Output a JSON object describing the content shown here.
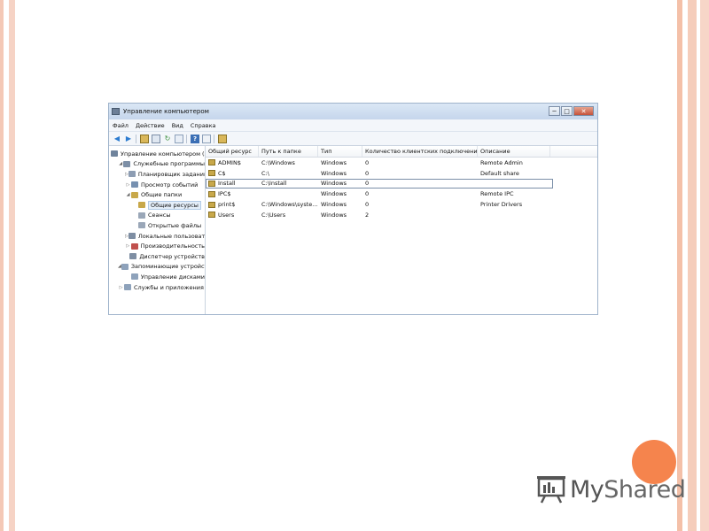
{
  "window": {
    "title": "Управление компьютером",
    "buttons": {
      "minimize": "─",
      "maximize": "□",
      "close": "✕"
    }
  },
  "menu": [
    "Файл",
    "Действие",
    "Вид",
    "Справка"
  ],
  "toolbar": [
    "back-icon",
    "forward-icon",
    "up-icon",
    "show-tree-icon",
    "refresh-icon",
    "export-icon",
    "help-icon",
    "properties-icon",
    "share-icon"
  ],
  "tree": [
    {
      "label": "Управление компьютером (л",
      "arrow": "",
      "indent": 0,
      "color": "#6f839c"
    },
    {
      "label": "Служебные программы",
      "arrow": "◢",
      "indent": 1,
      "color": "#7d8fa6"
    },
    {
      "label": "Планировщик заданий",
      "arrow": "▷",
      "indent": 2,
      "color": "#8d9db3"
    },
    {
      "label": "Просмотр событий",
      "arrow": "▷",
      "indent": 2,
      "color": "#7690b0"
    },
    {
      "label": "Общие папки",
      "arrow": "◢",
      "indent": 2,
      "color": "#c8a84a"
    },
    {
      "label": "Общие ресурсы",
      "arrow": "",
      "indent": 3,
      "color": "#c8a84a",
      "selected": true
    },
    {
      "label": "Сеансы",
      "arrow": "",
      "indent": 3,
      "color": "#9aa7b8"
    },
    {
      "label": "Открытые файлы",
      "arrow": "",
      "indent": 3,
      "color": "#9aa7b8"
    },
    {
      "label": "Локальные пользоват",
      "arrow": "▷",
      "indent": 2,
      "color": "#7e8ea3"
    },
    {
      "label": "Производительность",
      "arrow": "▷",
      "indent": 2,
      "color": "#c0504d"
    },
    {
      "label": "Диспетчер устройств",
      "arrow": "",
      "indent": 2,
      "color": "#7e8ea3"
    },
    {
      "label": "Запоминающие устройст",
      "arrow": "◢",
      "indent": 1,
      "color": "#8ea2bb"
    },
    {
      "label": "Управление дисками",
      "arrow": "",
      "indent": 2,
      "color": "#8ea2bb"
    },
    {
      "label": "Службы и приложения",
      "arrow": "▷",
      "indent": 1,
      "color": "#8ea2bb"
    }
  ],
  "columns": [
    "Общий ресурс",
    "Путь к папке",
    "Тип",
    "Количество клиентских подключений",
    "Описание"
  ],
  "rows": [
    [
      "ADMIN$",
      "C:\\Windows",
      "Windows",
      "0",
      "Remote Admin"
    ],
    [
      "C$",
      "C:\\",
      "Windows",
      "0",
      "Default share"
    ],
    [
      "Install",
      "C:\\Install",
      "Windows",
      "0",
      ""
    ],
    [
      "IPC$",
      "",
      "Windows",
      "0",
      "Remote IPC"
    ],
    [
      "print$",
      "C:\\Windows\\syste...",
      "Windows",
      "0",
      "Printer Drivers"
    ],
    [
      "Users",
      "C:\\Users",
      "Windows",
      "2",
      ""
    ]
  ],
  "logo": {
    "text_a": "My",
    "text_b": "Shared"
  },
  "colors": {
    "accent": "#f5844d",
    "frame": "#f4c8b6"
  }
}
